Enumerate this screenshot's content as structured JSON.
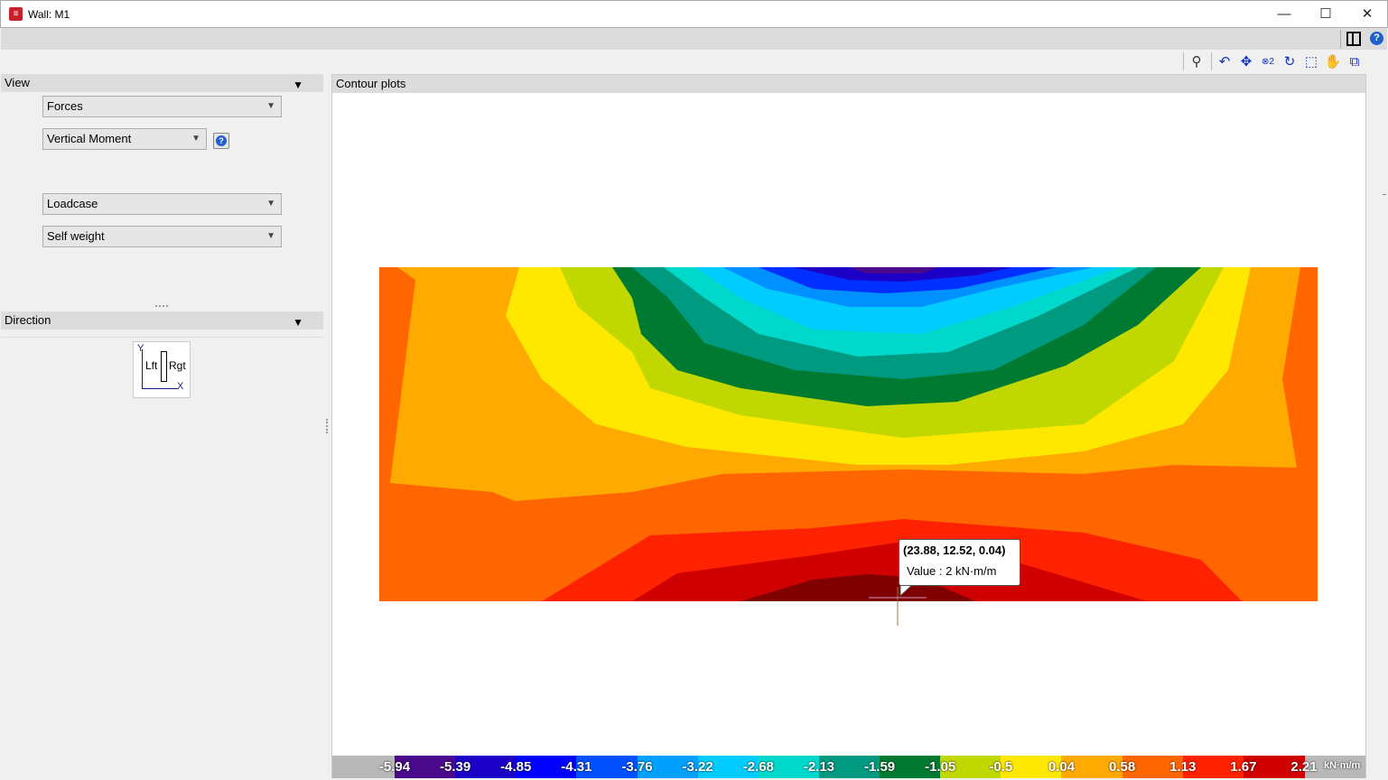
{
  "window": {
    "title": "Wall: M1",
    "minimize": "—",
    "maximize": "☐",
    "close": "✕"
  },
  "toolbar": {
    "icons": [
      "search-icon",
      "zoom-previous-icon",
      "zoom-all-icon",
      "zoom-x2-icon",
      "redraw-icon",
      "zoom-window-icon",
      "pan-hand-icon",
      "export-view-icon"
    ],
    "help": "?"
  },
  "view_panel": {
    "title": "View",
    "result_type": "Forces",
    "component": "Vertical Moment",
    "case_type": "Loadcase",
    "case": "Self weight"
  },
  "direction_panel": {
    "title": "Direction",
    "y": "Y",
    "x": "X",
    "left": "Lft",
    "right": "Rgt"
  },
  "plot": {
    "title": "Contour plots",
    "tooltip": {
      "coords": "(23.88, 12.52, 0.04)",
      "value": "Value : 2 kN·m/m"
    },
    "legend": {
      "unit": "kN·m/m",
      "labels": [
        "-5.94",
        "-5.39",
        "-4.85",
        "-4.31",
        "-3.76",
        "-3.22",
        "-2.68",
        "-2.13",
        "-1.59",
        "-1.05",
        "-0.5",
        "0.04",
        "0.58",
        "1.13",
        "1.67",
        "2.21"
      ],
      "colors": [
        "#4b0a8c",
        "#1c00c8",
        "#0000ff",
        "#0050ff",
        "#00a0ff",
        "#00ccff",
        "#00d8cc",
        "#009a80",
        "#007a30",
        "#c0d800",
        "#ffe800",
        "#ffaa00",
        "#ff6600",
        "#ff2200",
        "#d00000"
      ]
    }
  }
}
